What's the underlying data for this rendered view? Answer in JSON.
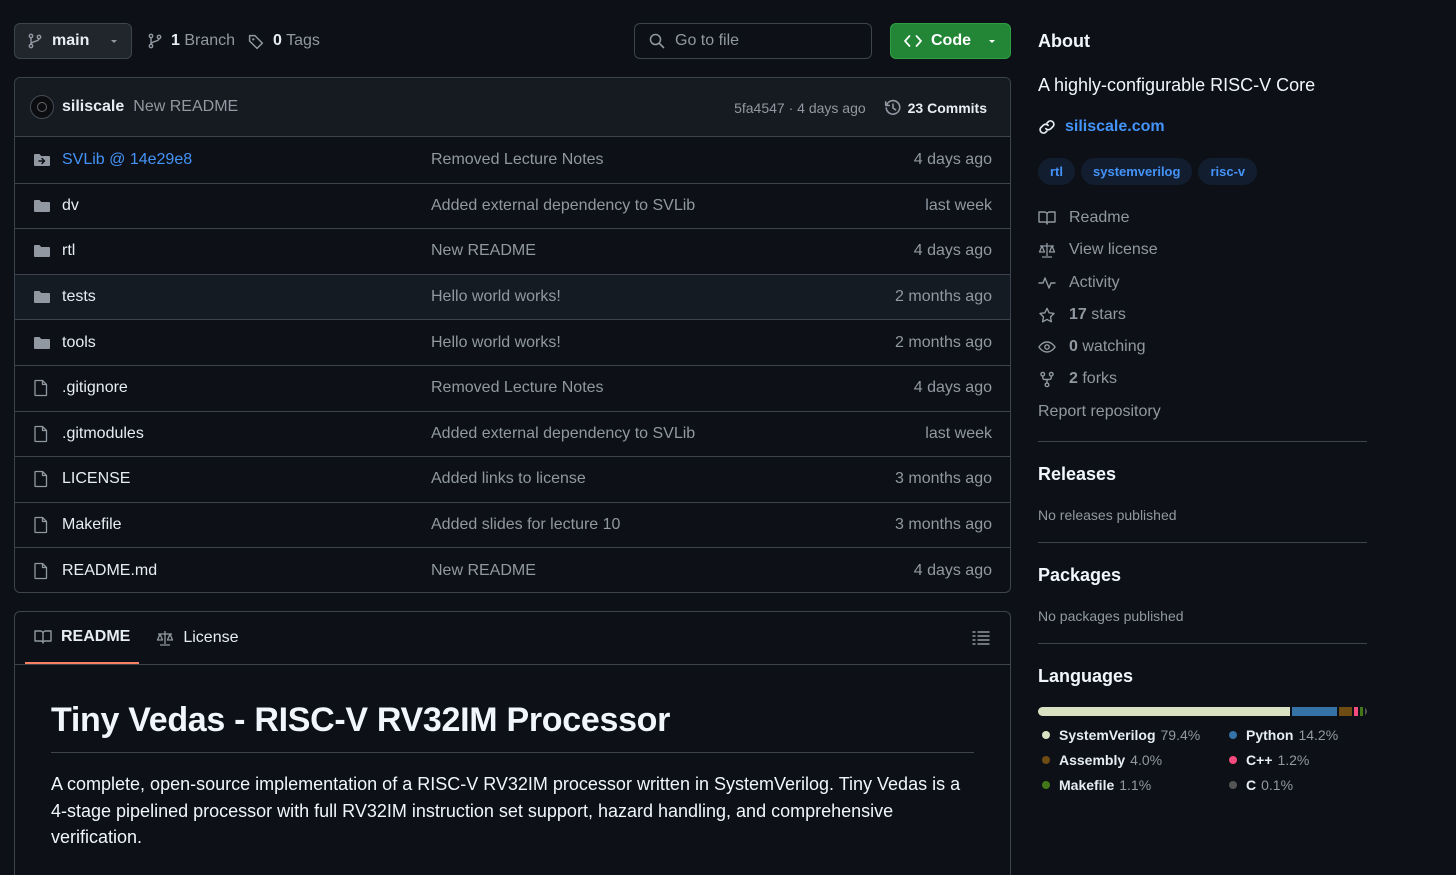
{
  "toolbar": {
    "branch": "main",
    "branch_count": "1",
    "branch_label": "Branch",
    "tag_count": "0",
    "tag_label": "Tags",
    "search_placeholder": "Go to file",
    "code_label": "Code"
  },
  "latest_commit": {
    "author": "siliscale",
    "message": "New README",
    "sha_time": "5fa4547 · 4 days ago",
    "commit_count": "23 Commits"
  },
  "files": [
    {
      "name": "SVLib @ 14e29e8",
      "type": "submodule",
      "message": "Removed Lecture Notes",
      "date": "4 days ago"
    },
    {
      "name": "dv",
      "type": "folder",
      "message": "Added external dependency to SVLib",
      "date": "last week"
    },
    {
      "name": "rtl",
      "type": "folder",
      "message": "New README",
      "date": "4 days ago"
    },
    {
      "name": "tests",
      "type": "folder",
      "message": "Hello world works!",
      "date": "2 months ago"
    },
    {
      "name": "tools",
      "type": "folder",
      "message": "Hello world works!",
      "date": "2 months ago"
    },
    {
      "name": ".gitignore",
      "type": "file",
      "message": "Removed Lecture Notes",
      "date": "4 days ago"
    },
    {
      "name": ".gitmodules",
      "type": "file",
      "message": "Added external dependency to SVLib",
      "date": "last week"
    },
    {
      "name": "LICENSE",
      "type": "file",
      "message": "Added links to license",
      "date": "3 months ago"
    },
    {
      "name": "Makefile",
      "type": "file",
      "message": "Added slides for lecture 10",
      "date": "3 months ago"
    },
    {
      "name": "README.md",
      "type": "file",
      "message": "New README",
      "date": "4 days ago"
    }
  ],
  "readme": {
    "tab_readme": "README",
    "tab_license": "License",
    "title": "Tiny Vedas - RISC-V RV32IM Processor",
    "paragraph": "A complete, open-source implementation of a RISC-V RV32IM processor written in SystemVerilog. Tiny Vedas is a 4-stage pipelined processor with full RV32IM instruction set support, hazard handling, and comprehensive verification."
  },
  "about": {
    "heading": "About",
    "description": "A highly-configurable RISC-V Core",
    "website": "siliscale.com",
    "topics": [
      "rtl",
      "systemverilog",
      "risc-v"
    ],
    "readme": "Readme",
    "license": "View license",
    "activity": "Activity",
    "stars_count": "17",
    "stars_label": "stars",
    "watching_count": "0",
    "watching_label": "watching",
    "forks_count": "2",
    "forks_label": "forks",
    "report": "Report repository"
  },
  "releases": {
    "heading": "Releases",
    "note": "No releases published"
  },
  "packages": {
    "heading": "Packages",
    "note": "No packages published"
  },
  "languages": {
    "heading": "Languages",
    "items": [
      {
        "name": "SystemVerilog",
        "percent": "79.4%",
        "value": 79.4,
        "color": "#dae1c2"
      },
      {
        "name": "Python",
        "percent": "14.2%",
        "value": 14.2,
        "color": "#3572a5"
      },
      {
        "name": "Assembly",
        "percent": "4.0%",
        "value": 4.0,
        "color": "#6e4c13"
      },
      {
        "name": "C++",
        "percent": "1.2%",
        "value": 1.2,
        "color": "#f34b7d"
      },
      {
        "name": "Makefile",
        "percent": "1.1%",
        "value": 1.1,
        "color": "#427819"
      },
      {
        "name": "C",
        "percent": "0.1%",
        "value": 0.1,
        "color": "#555555"
      }
    ]
  }
}
